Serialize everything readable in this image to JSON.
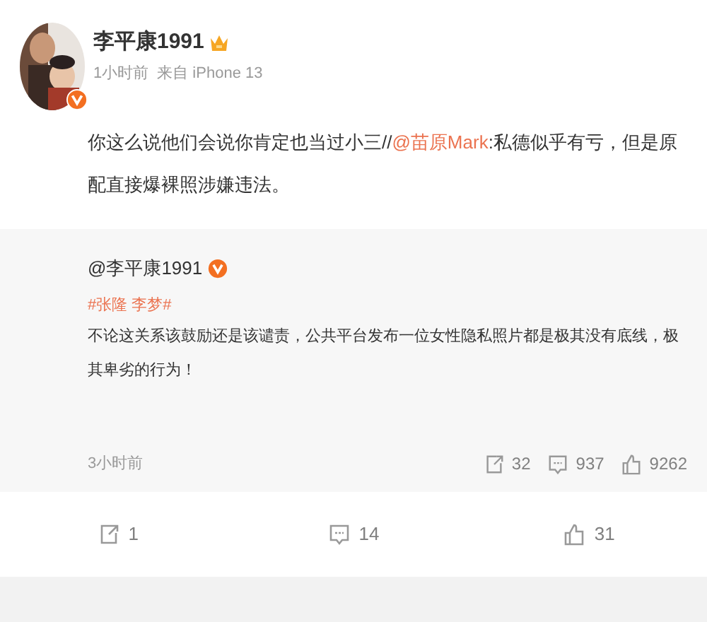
{
  "post": {
    "author": "李平康1991",
    "time": "1小时前",
    "source": "来自 iPhone 13",
    "body": [
      {
        "kind": "text",
        "text": "你这么说他们会说你肯定也当过小三//"
      },
      {
        "kind": "mention",
        "text": "@苗原Mark"
      },
      {
        "kind": "text",
        "text": ":私德似乎有亏，但是原配直接爆裸照涉嫌违法。"
      }
    ]
  },
  "retweet": {
    "author": "@李平康1991",
    "hashtag": "#张隆 李梦#",
    "body": "不论这关系该鼓励还是该谴责，公共平台发布一位女性隐私照片都是极其没有底线，极其卑劣的行为！",
    "time": "3小时前",
    "stats": [
      {
        "kind": "repost",
        "count": "32"
      },
      {
        "kind": "comment",
        "count": "937"
      },
      {
        "kind": "like",
        "count": "9262"
      }
    ]
  },
  "actions": [
    {
      "kind": "repost",
      "count": "1"
    },
    {
      "kind": "comment",
      "count": "14"
    },
    {
      "kind": "like",
      "count": "31"
    }
  ]
}
